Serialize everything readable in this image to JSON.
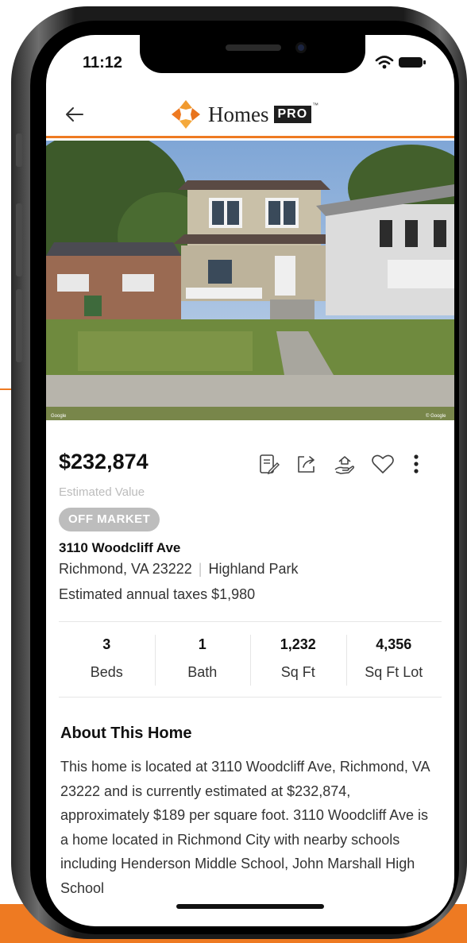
{
  "status_bar": {
    "time": "11:12"
  },
  "header": {
    "brand": "Homes",
    "brand_badge": "PRO",
    "brand_tm": "™"
  },
  "photo": {
    "watermark_left": "Google",
    "watermark_right": "© Google"
  },
  "listing": {
    "price": "$232,874",
    "price_caption": "Estimated Value",
    "status_badge": "OFF MARKET",
    "address": "3110 Woodcliff Ave",
    "city": "Richmond, VA 23222",
    "neighborhood": "Highland Park",
    "taxes": "Estimated annual taxes $1,980"
  },
  "actions": [
    {
      "icon": "edit-document-icon"
    },
    {
      "icon": "share-icon"
    },
    {
      "icon": "offer-hand-icon"
    },
    {
      "icon": "heart-icon"
    },
    {
      "icon": "more-vertical-icon"
    }
  ],
  "stats": [
    {
      "value": "3",
      "label": "Beds"
    },
    {
      "value": "1",
      "label": "Bath"
    },
    {
      "value": "1,232",
      "label": "Sq Ft"
    },
    {
      "value": "4,356",
      "label": "Sq Ft Lot"
    }
  ],
  "about": {
    "title": "About This Home",
    "text": "This home is located at 3110 Woodcliff Ave, Richmond, VA 23222 and is currently estimated at $232,874, approximately $189 per square foot. 3110 Woodcliff Ave is a home located in Richmond City with nearby schools including Henderson Middle School, John Marshall High School"
  },
  "colors": {
    "accent": "#ee7a22",
    "badge_gray": "#bdbdbd",
    "text": "#111111"
  }
}
